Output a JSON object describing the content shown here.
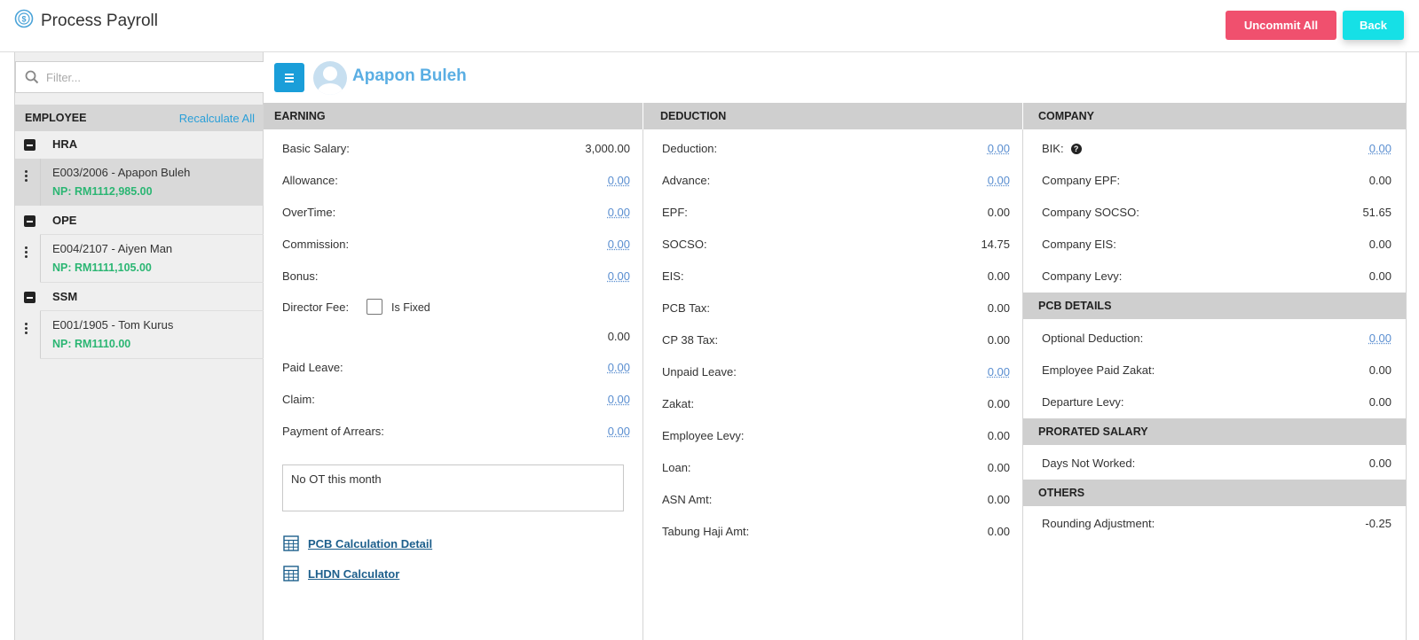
{
  "header": {
    "title": "Process Payroll",
    "uncommit_label": "Uncommit All",
    "back_label": "Back"
  },
  "sidebar": {
    "filter_placeholder": "Filter...",
    "column_label": "EMPLOYEE",
    "recalc_label": "Recalculate All",
    "groups": [
      {
        "name": "HRA",
        "employees": [
          {
            "name": "E003/2006 - Apapon Buleh",
            "np": "NP: RM1112,985.00"
          }
        ]
      },
      {
        "name": "OPE",
        "employees": [
          {
            "name": "E004/2107 - Aiyen Man",
            "np": "NP: RM1111,105.00"
          }
        ]
      },
      {
        "name": "SSM",
        "employees": [
          {
            "name": "E001/1905 - Tom Kurus",
            "np": "NP: RM1110.00"
          }
        ]
      }
    ]
  },
  "main": {
    "employee_name": "Apapon Buleh",
    "earning": {
      "title": "EARNING",
      "rows": [
        {
          "label": "Basic Salary:",
          "value": "3,000.00"
        },
        {
          "label": "Allowance:",
          "value": "0.00"
        },
        {
          "label": "OverTime:",
          "value": "0.00"
        },
        {
          "label": "Commission:",
          "value": "0.00"
        },
        {
          "label": "Bonus:",
          "value": "0.00"
        },
        {
          "label": "Director Fee:",
          "value": "0.00"
        },
        {
          "label": "Paid Leave:",
          "value": "0.00"
        },
        {
          "label": "Claim:",
          "value": "0.00"
        },
        {
          "label": "Payment of Arrears:",
          "value": "0.00"
        }
      ],
      "is_fixed_label": "Is Fixed",
      "note": "No OT this month",
      "pcb_link": "PCB Calculation Detail",
      "lhdn_link": "LHDN Calculator"
    },
    "deduction": {
      "title": "DEDUCTION",
      "rows": [
        {
          "label": "Deduction:",
          "value": "0.00"
        },
        {
          "label": "Advance:",
          "value": "0.00"
        },
        {
          "label": "EPF:",
          "value": "0.00"
        },
        {
          "label": "SOCSO:",
          "value": "14.75"
        },
        {
          "label": "EIS:",
          "value": "0.00"
        },
        {
          "label": "PCB Tax:",
          "value": "0.00"
        },
        {
          "label": "CP 38 Tax:",
          "value": "0.00"
        },
        {
          "label": "Unpaid Leave:",
          "value": "0.00"
        },
        {
          "label": "Zakat:",
          "value": "0.00"
        },
        {
          "label": "Employee Levy:",
          "value": "0.00"
        },
        {
          "label": "Loan:",
          "value": "0.00"
        },
        {
          "label": "ASN Amt:",
          "value": "0.00"
        },
        {
          "label": "Tabung Haji Amt:",
          "value": "0.00"
        }
      ]
    },
    "company": {
      "title": "COMPANY",
      "rows": [
        {
          "label": "BIK:",
          "value": "0.00"
        },
        {
          "label": "Company EPF:",
          "value": "0.00"
        },
        {
          "label": "Company SOCSO:",
          "value": "51.65"
        },
        {
          "label": "Company EIS:",
          "value": "0.00"
        },
        {
          "label": "Company Levy:",
          "value": "0.00"
        }
      ]
    },
    "pcb_details": {
      "title": "PCB DETAILS",
      "rows": [
        {
          "label": "Optional Deduction:",
          "value": "0.00"
        },
        {
          "label": "Employee Paid Zakat:",
          "value": "0.00"
        },
        {
          "label": "Departure Levy:",
          "value": "0.00"
        }
      ]
    },
    "prorated": {
      "title": "PRORATED SALARY",
      "rows": [
        {
          "label": "Days Not Worked:",
          "value": "0.00"
        }
      ]
    },
    "others": {
      "title": "OTHERS",
      "rows": [
        {
          "label": "Rounding Adjustment:",
          "value": "-0.25"
        }
      ]
    }
  },
  "colors": {
    "primary": "#1a9ed9",
    "danger": "#f0506e",
    "cyan": "#16e0e6",
    "success": "#2bb673",
    "link": "#5a8ed0"
  }
}
